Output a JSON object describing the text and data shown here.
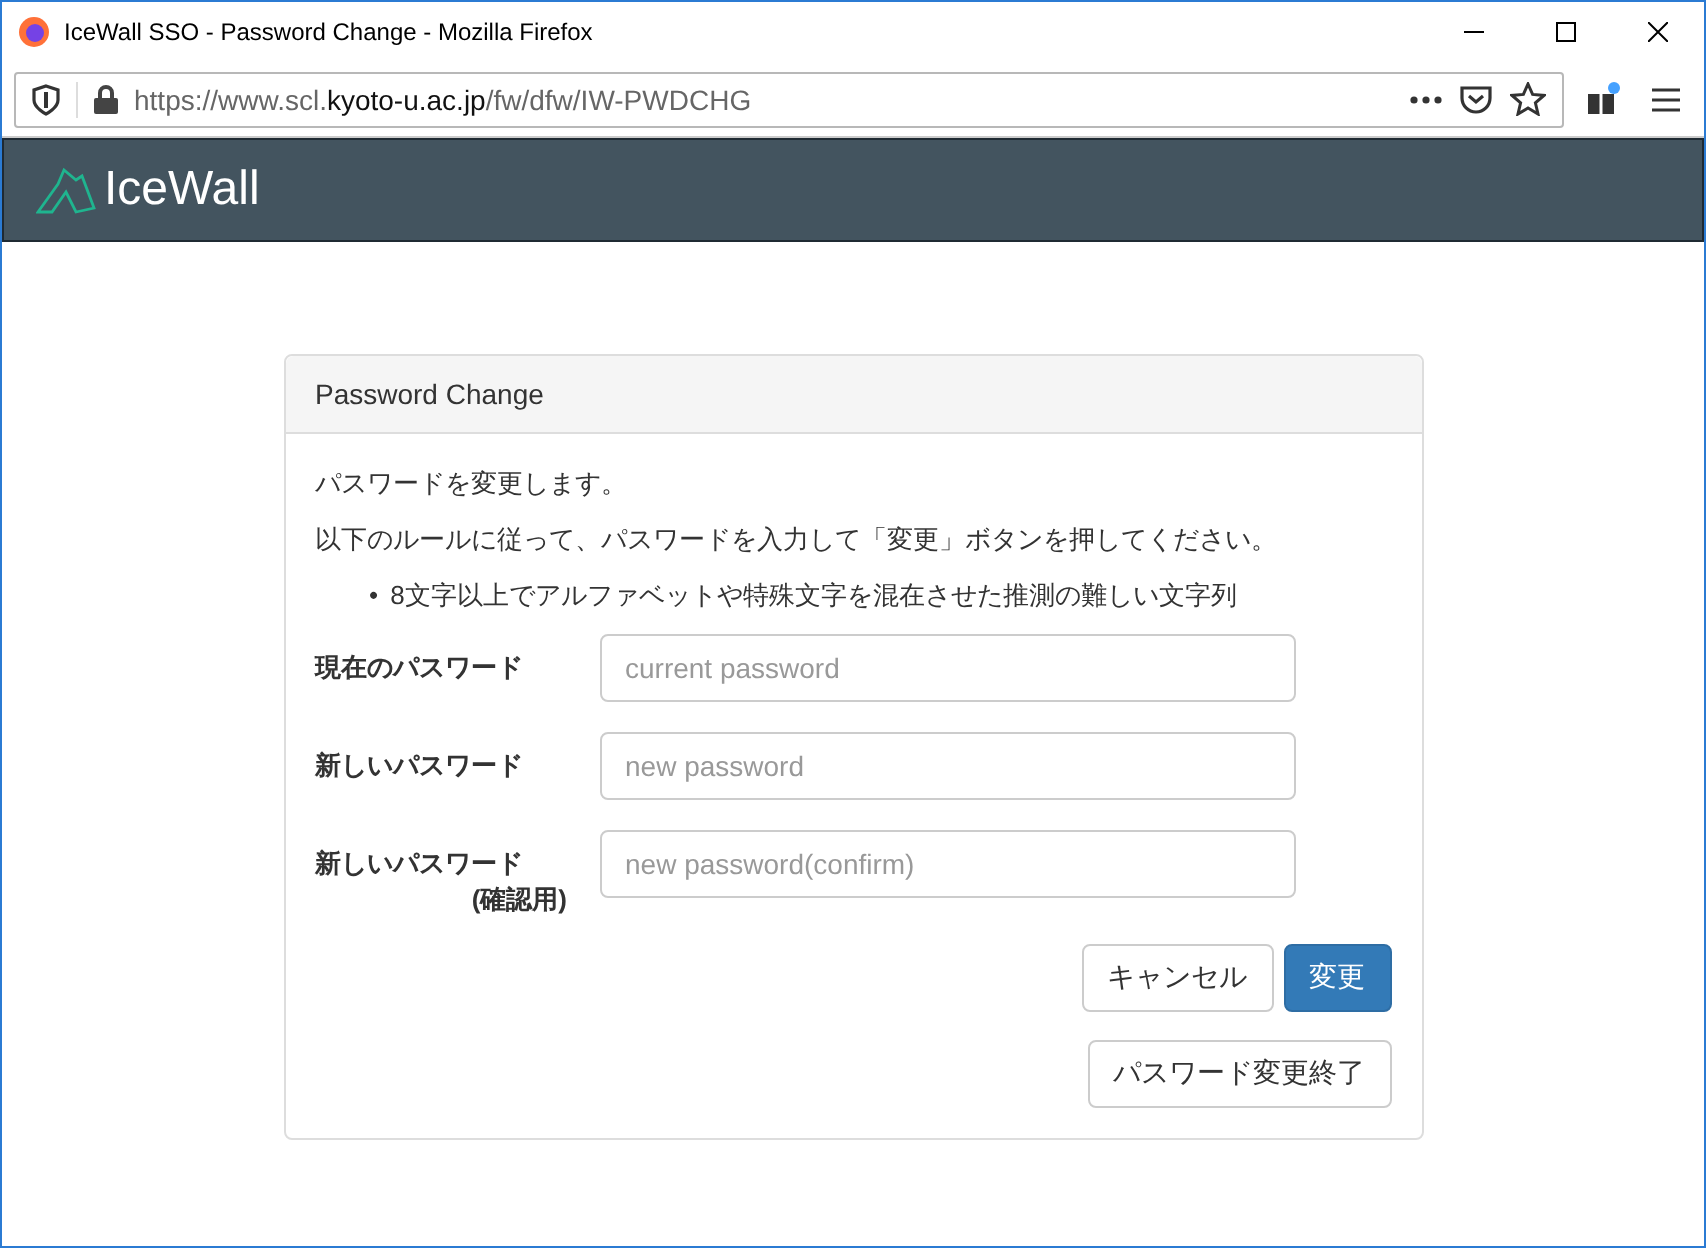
{
  "window": {
    "title": "IceWall SSO - Password Change - Mozilla Firefox"
  },
  "address_bar": {
    "prefix": "https://www.scl.",
    "host": "kyoto-u.ac.jp",
    "path": "/fw/dfw/IW-PWDCHG"
  },
  "header": {
    "logo_text": "IceWall"
  },
  "panel": {
    "title": "Password Change",
    "intro": "パスワードを変更します。",
    "instruction": "以下のルールに従って、パスワードを入力して「変更」ボタンを押してください。",
    "rules": [
      {
        "marker": "•",
        "text": "8文字以上でアルファベットや特殊文字を混在させた推測の難しい文字列"
      }
    ],
    "fields": [
      {
        "label": [
          "現在のパスワード"
        ],
        "placeholder": "current password"
      },
      {
        "label": [
          "新しいパスワード"
        ],
        "placeholder": "new password"
      },
      {
        "label": [
          "新しいパスワード",
          "(確認用)"
        ],
        "placeholder": "new password(confirm)"
      }
    ],
    "buttons": [
      {
        "label": "キャンセル",
        "kind": "default"
      },
      {
        "label": "変更",
        "kind": "primary"
      }
    ],
    "finish_button": {
      "label": "パスワード変更終了"
    }
  }
}
